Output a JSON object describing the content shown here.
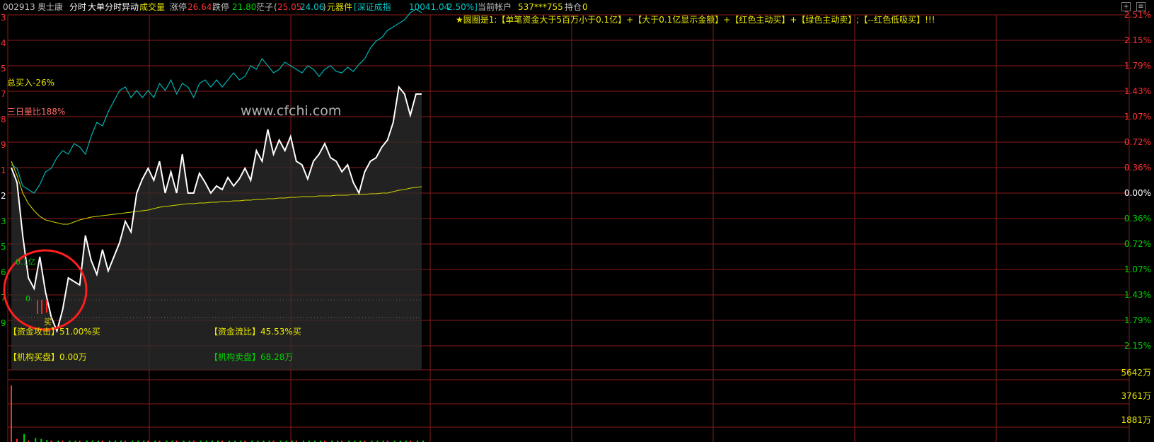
{
  "header": {
    "code": "002913",
    "name": "奥士康",
    "view_fenshi": "分时",
    "view_dadan": "大单分时异动",
    "view_volume": "成交量",
    "limit_up_label": "涨停",
    "limit_up_value": "26.64",
    "limit_down_label": "跌停",
    "limit_down_value": "21.80",
    "indicator_label": "茫子",
    "indicator_open": "(",
    "indicator_v1": "25.05",
    "indicator_v2": "24.06",
    "indicator_close": ")",
    "sector": "元器件",
    "index_label": "[深证成指",
    "index_value": "10041.04",
    "index_pct": "2.50%]",
    "account_label": "当前帐户",
    "account_value": "537***755",
    "position_label": "持仓",
    "position_value": "0",
    "plus_icon": "plus-icon",
    "settings_icon": "settings-icon",
    "colors": {
      "up": "#ff3232",
      "down": "#00d200",
      "yellow": "#e8e800",
      "cyan": "#00c8c8",
      "grid": "#8b1a1a"
    }
  },
  "watermark": "www.cfchi.com",
  "formula_note": "★圆圈是1:【单笔资金大于5百万小于0.1亿】+【大于0.1亿显示金额】+【红色主动买】+【绿色主动卖】;【--红色低吸买】!!!",
  "annotations": {
    "total_buy": "总买入-26%",
    "vol_ratio_3d": "三日量比188%",
    "marker_01": "0.1亿",
    "marker_0": "0",
    "marker_buy": "买"
  },
  "stats": {
    "attack_label": "【资金攻击】",
    "attack_value": "51.00%买",
    "flow_label": "【资金流比】",
    "flow_value": "45.53%买",
    "inst_buy_label": "【机构买盘】",
    "inst_buy_value": "0.00万",
    "inst_sell_label": "【机构卖盘】",
    "inst_sell_value": "68.28万"
  },
  "left_axis_fragments": [
    "3",
    "4",
    "5",
    "7",
    "8",
    "9",
    "1",
    "2",
    "3",
    "5",
    "6",
    "7",
    "9"
  ],
  "chart_data": {
    "type": "line",
    "title": "",
    "pct_ticks": [
      "2.51%",
      "2.15%",
      "1.79%",
      "1.43%",
      "1.07%",
      "0.72%",
      "0.36%",
      "0.00%",
      "0.36%",
      "0.72%",
      "1.07%",
      "1.43%",
      "1.79%",
      "2.15%"
    ],
    "ylim_pct": [
      -2.33,
      2.51
    ],
    "volume_ticks": [
      "5642万",
      "3761万",
      "1881万"
    ],
    "volume_ylim": [
      0,
      6200
    ],
    "series": [
      {
        "kind": "stock_price_pct",
        "values": [
          0.36,
          0.15,
          -0.6,
          -1.2,
          -1.35,
          -0.9,
          -1.4,
          -1.75,
          -1.95,
          -1.65,
          -1.2,
          -1.25,
          -1.3,
          -0.6,
          -0.95,
          -1.15,
          -0.8,
          -1.1,
          -0.9,
          -0.7,
          -0.4,
          -0.55,
          0.0,
          0.2,
          0.35,
          0.18,
          0.45,
          0.0,
          0.3,
          0.0,
          0.55,
          0.0,
          0.0,
          0.28,
          0.15,
          0.0,
          0.1,
          0.05,
          0.22,
          0.1,
          0.2,
          0.35,
          0.18,
          0.6,
          0.45,
          0.9,
          0.55,
          0.75,
          0.6,
          0.8,
          0.45,
          0.4,
          0.2,
          0.45,
          0.55,
          0.7,
          0.5,
          0.45,
          0.3,
          0.4,
          0.15,
          0.0,
          0.3,
          0.45,
          0.5,
          0.65,
          0.75,
          1.0,
          1.5,
          1.4,
          1.1,
          1.4,
          1.4
        ]
      },
      {
        "kind": "avg_price_pct",
        "values": [
          0.45,
          0.25,
          0.0,
          -0.15,
          -0.25,
          -0.33,
          -0.38,
          -0.4,
          -0.42,
          -0.44,
          -0.44,
          -0.41,
          -0.38,
          -0.36,
          -0.34,
          -0.33,
          -0.32,
          -0.31,
          -0.3,
          -0.29,
          -0.28,
          -0.27,
          -0.26,
          -0.25,
          -0.24,
          -0.22,
          -0.2,
          -0.19,
          -0.18,
          -0.17,
          -0.16,
          -0.15,
          -0.15,
          -0.14,
          -0.14,
          -0.13,
          -0.13,
          -0.12,
          -0.12,
          -0.11,
          -0.11,
          -0.1,
          -0.1,
          -0.09,
          -0.09,
          -0.08,
          -0.08,
          -0.07,
          -0.07,
          -0.06,
          -0.06,
          -0.05,
          -0.05,
          -0.05,
          -0.04,
          -0.04,
          -0.04,
          -0.03,
          -0.03,
          -0.03,
          -0.02,
          -0.02,
          -0.02,
          -0.01,
          -0.01,
          0.0,
          0.0,
          0.02,
          0.04,
          0.05,
          0.07,
          0.08,
          0.09
        ]
      },
      {
        "kind": "index_pct",
        "values": [
          0.4,
          0.35,
          0.1,
          0.05,
          0.0,
          0.12,
          0.3,
          0.35,
          0.5,
          0.6,
          0.55,
          0.7,
          0.65,
          0.55,
          0.8,
          1.0,
          0.95,
          1.15,
          1.3,
          1.45,
          1.5,
          1.35,
          1.45,
          1.35,
          1.45,
          1.35,
          1.55,
          1.45,
          1.6,
          1.4,
          1.55,
          1.5,
          1.35,
          1.55,
          1.6,
          1.5,
          1.6,
          1.5,
          1.6,
          1.7,
          1.6,
          1.65,
          1.8,
          1.75,
          1.9,
          1.8,
          1.7,
          1.75,
          1.85,
          1.8,
          1.75,
          1.7,
          1.8,
          1.75,
          1.65,
          1.75,
          1.8,
          1.72,
          1.7,
          1.78,
          1.72,
          1.82,
          1.9,
          2.05,
          2.15,
          2.2,
          2.3,
          2.35,
          2.4,
          2.45,
          2.55,
          2.6,
          2.55
        ]
      }
    ],
    "volume_up": [
      5642,
      300,
      0,
      150,
      0,
      0,
      0,
      80,
      0,
      40,
      0,
      0,
      60,
      0,
      0,
      0,
      70,
      0,
      0,
      0,
      50,
      0,
      0,
      0,
      90,
      0,
      120,
      0,
      0,
      40,
      0,
      0,
      60,
      0,
      0,
      0,
      0,
      50,
      0,
      0,
      0,
      70,
      0,
      0,
      0,
      0,
      60,
      0,
      0,
      0,
      80,
      0,
      0,
      0,
      0,
      40,
      0,
      0,
      60,
      0,
      0,
      0,
      50,
      0,
      0,
      0,
      70,
      0,
      0,
      0,
      60,
      0,
      0
    ],
    "volume_down": [
      0,
      0,
      800,
      0,
      420,
      300,
      200,
      0,
      150,
      0,
      120,
      100,
      0,
      90,
      80,
      70,
      0,
      60,
      50,
      40,
      0,
      30,
      30,
      30,
      0,
      40,
      0,
      30,
      30,
      0,
      30,
      30,
      0,
      30,
      30,
      40,
      30,
      0,
      30,
      30,
      30,
      0,
      30,
      30,
      30,
      30,
      0,
      30,
      30,
      30,
      0,
      30,
      30,
      30,
      30,
      0,
      30,
      30,
      0,
      30,
      30,
      30,
      0,
      30,
      30,
      30,
      0,
      30,
      30,
      30,
      0,
      30,
      30
    ]
  }
}
